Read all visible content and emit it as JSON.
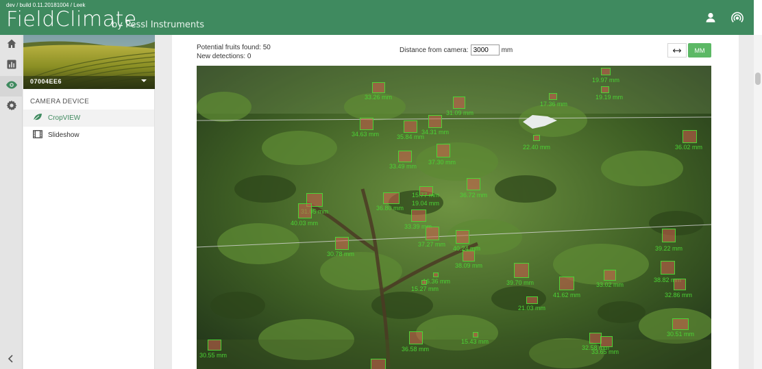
{
  "header": {
    "build": "dev / build 0.11.20181004 / Leek",
    "logo": "FieldClimate",
    "logo_sub": "by Pessl Instruments"
  },
  "rail": {
    "items": [
      "home-icon",
      "chart-icon",
      "eye-icon",
      "gear-icon"
    ],
    "active": "eye-icon",
    "collapse_icon": "chevron-left-icon"
  },
  "sidebar": {
    "station": "07004EE6",
    "section_title": "CAMERA DEVICE",
    "items": [
      {
        "label": "CropVIEW",
        "icon": "leaf-icon",
        "active": true
      },
      {
        "label": "Slideshow",
        "icon": "film-icon",
        "active": false
      }
    ]
  },
  "main": {
    "fruits_found": "Potential fruits found: 50",
    "new_detections": "New detections: 0",
    "distance_label": "Distance from camera:",
    "distance_value": "3000",
    "distance_unit": "mm",
    "mm_button": "MM"
  },
  "detections": [
    {
      "label": "33.26 mm"
    },
    {
      "label": "19.97 mm"
    },
    {
      "label": "17.36 mm"
    },
    {
      "label": "19.19 mm"
    },
    {
      "label": "31.09 mm"
    },
    {
      "label": "34.63 mm"
    },
    {
      "label": "35.84 mm"
    },
    {
      "label": "34.31 mm"
    },
    {
      "label": "22.40 mm"
    },
    {
      "label": "36.02 mm"
    },
    {
      "label": "33.49 mm"
    },
    {
      "label": "37.30 mm"
    },
    {
      "label": "15.77 mm"
    },
    {
      "label": "19.04 mm"
    },
    {
      "label": "36.72 mm"
    },
    {
      "label": "36.80 mm"
    },
    {
      "label": "31.05 mm"
    },
    {
      "label": "40.03 mm"
    },
    {
      "label": "33.39 mm"
    },
    {
      "label": "37.27 mm"
    },
    {
      "label": "40.24 mm"
    },
    {
      "label": "39.22 mm"
    },
    {
      "label": "30.78 mm"
    },
    {
      "label": "38.09 mm"
    },
    {
      "label": "39.70 mm"
    },
    {
      "label": "38.82 mm"
    },
    {
      "label": "16.36 mm"
    },
    {
      "label": "15.27 mm"
    },
    {
      "label": "41.62 mm"
    },
    {
      "label": "33.02 mm"
    },
    {
      "label": "32.86 mm"
    },
    {
      "label": "21.03 mm"
    },
    {
      "label": "30.55 mm"
    },
    {
      "label": "36.58 mm"
    },
    {
      "label": "15.43 mm"
    },
    {
      "label": "32.58 mm"
    },
    {
      "label": "33.65 mm"
    },
    {
      "label": "30.51 mm"
    }
  ]
}
